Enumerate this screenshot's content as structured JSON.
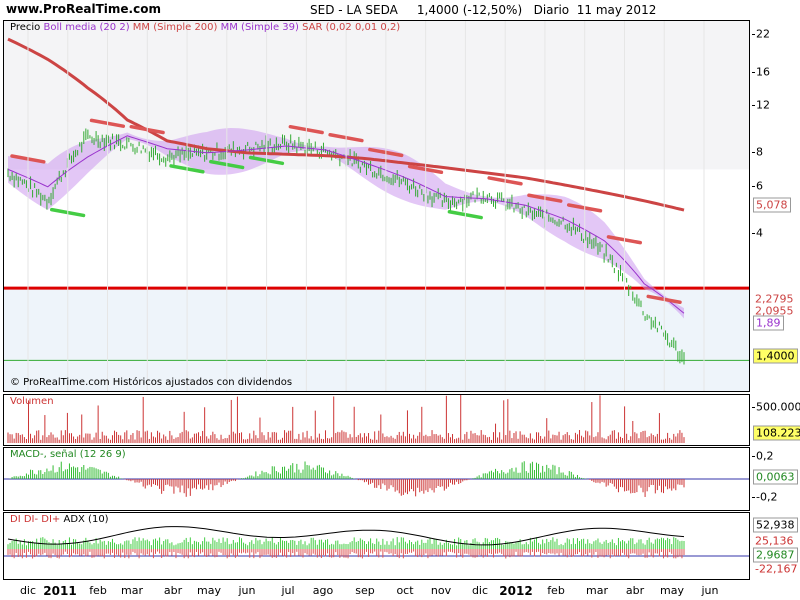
{
  "header": {
    "site": "www.ProRealTime.com",
    "title": "SED - LA SEDA     1,4000 (-12,50%)   Diario  11 may 2012"
  },
  "main_panel": {
    "legend": {
      "precio": "Precio",
      "boll": "Boll media (20 2)",
      "mm200": "MM (Simple 200)",
      "mm39": "MM (Simple 39)",
      "sar": "SAR (0,02 0,01 0,2)"
    },
    "footer": "© ProRealTime.com  Históricos ajustados con dividendos",
    "scale_labels": [
      "22",
      "16",
      "12",
      "8",
      "6",
      "4"
    ],
    "value_boxes": {
      "mm200": "5,078",
      "upper": "2,2795",
      "mid": "2,0955",
      "lower": "1,89",
      "price": "1,4000"
    }
  },
  "volume_panel": {
    "label": "Volumen",
    "scale_label": "500.000",
    "value": "108.223"
  },
  "macd_panel": {
    "label": "MACD-, señal (12 26 9)",
    "scale_labels": [
      "0,2",
      "-0,2"
    ],
    "value": "0,0063"
  },
  "dmi_panel": {
    "label_di": "DI DI- DI+",
    "label_adx": "ADX (10)",
    "values": [
      "52,938",
      "25,136",
      "2,9687",
      "-22,167"
    ]
  },
  "x_axis": [
    "dic",
    "2011",
    "feb",
    "mar",
    "abr",
    "may",
    "jun",
    "jul",
    "ago",
    "sep",
    "oct",
    "nov",
    "dic",
    "2012",
    "feb",
    "mar",
    "abr",
    "may",
    "jun"
  ],
  "colors": {
    "price_bar": "#33aa33",
    "sar_up": "#44cc44",
    "sar_down": "#dd5555",
    "mm200": "#cc4444",
    "mm39": "#9933cc",
    "boll_band": "#cc99ee",
    "support_line": "#dd0000",
    "volume_bar": "#cc3333",
    "macd_bar": "#33bb33",
    "adx_line": "#000000"
  },
  "chart_data": [
    {
      "type": "line",
      "title": "SED - LA SEDA",
      "x": [
        "2010-12",
        "2011-01",
        "2011-02",
        "2011-03",
        "2011-04",
        "2011-05",
        "2011-06",
        "2011-07",
        "2011-08",
        "2011-09",
        "2011-10",
        "2011-11",
        "2011-12",
        "2012-01",
        "2012-02",
        "2012-03",
        "2012-04",
        "2012-05"
      ],
      "ylim": [
        1.3,
        24
      ],
      "y_scale": "log",
      "series": [
        {
          "name": "Precio",
          "values": [
            7.0,
            5.5,
            9.5,
            9.0,
            8.0,
            8.3,
            8.6,
            9.0,
            8.4,
            7.4,
            6.4,
            5.4,
            5.8,
            5.0,
            4.6,
            3.5,
            2.1,
            1.4
          ]
        },
        {
          "name": "MM (Simple 200)",
          "values": [
            22.0,
            18.5,
            14.5,
            11.0,
            9.2,
            8.6,
            8.3,
            8.2,
            8.1,
            7.9,
            7.6,
            7.3,
            7.0,
            6.7,
            6.3,
            5.9,
            5.5,
            5.078
          ]
        },
        {
          "name": "MM (Simple 39)",
          "values": [
            7.2,
            6.2,
            8.0,
            9.6,
            8.6,
            8.3,
            8.5,
            8.8,
            8.5,
            7.6,
            6.7,
            5.7,
            5.6,
            5.3,
            4.7,
            3.9,
            2.7,
            2.0955
          ]
        }
      ],
      "hline": 2.6,
      "last_price": 1.4
    },
    {
      "type": "bar",
      "title": "Volumen",
      "ylim": [
        0,
        800000
      ],
      "last": 108223
    },
    {
      "type": "bar",
      "title": "MACD-, señal (12 26 9)",
      "ylim": [
        -0.4,
        0.4
      ],
      "last": 0.0063
    },
    {
      "type": "line",
      "title": "DI DI- DI+ / ADX (10)",
      "series": [
        {
          "name": "ADX (10)",
          "last": 52.938
        },
        {
          "name": "DI-",
          "last": 25.136
        },
        {
          "name": "DI+",
          "last": 2.9687
        },
        {
          "name": "DI",
          "last": -22.167
        }
      ]
    }
  ]
}
